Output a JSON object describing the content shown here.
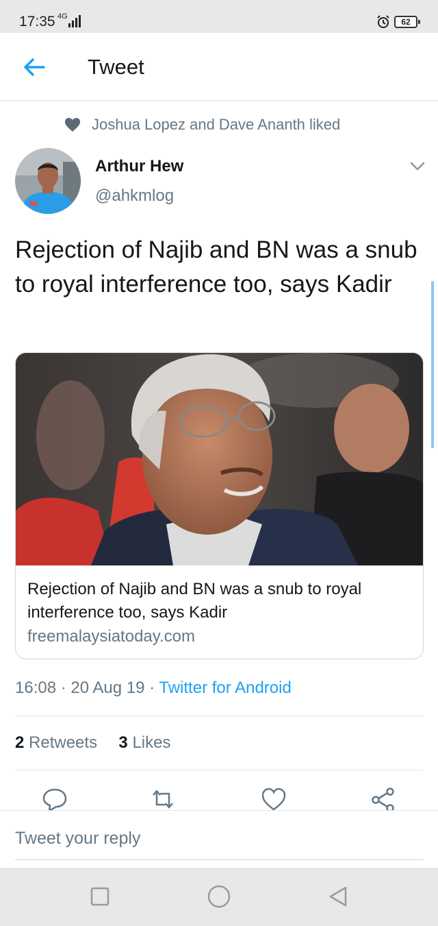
{
  "status_bar": {
    "time": "17:35",
    "network": "4G",
    "battery": "62"
  },
  "header": {
    "title": "Tweet",
    "back_icon": "arrow-left-icon"
  },
  "social_context": {
    "icon": "heart-icon",
    "text": "Joshua Lopez and Dave Ananth liked"
  },
  "tweet": {
    "author_name": "Arthur Hew",
    "author_handle": "@ahkmlog",
    "text": "Rejection of Najib and BN was a snub to royal interference too, says Kadir",
    "timestamp": "16:08 · 20 Aug 19 · ",
    "source": "Twitter for Android",
    "card": {
      "title": "Rejection of Najib and BN was a snub to royal interference too, says Kadir",
      "domain": "freemalaysiatoday.com"
    },
    "stats": {
      "retweets_count": "2",
      "retweets_label": " Retweets",
      "likes_count": "3",
      "likes_label": " Likes"
    }
  },
  "actions": {
    "reply_icon": "reply-icon",
    "retweet_icon": "retweet-icon",
    "like_icon": "heart-outline-icon",
    "share_icon": "share-icon"
  },
  "reply_bar": {
    "placeholder": "Tweet your reply"
  },
  "colors": {
    "accent": "#1da1f2",
    "text_primary": "#14171a",
    "text_secondary": "#657786"
  }
}
